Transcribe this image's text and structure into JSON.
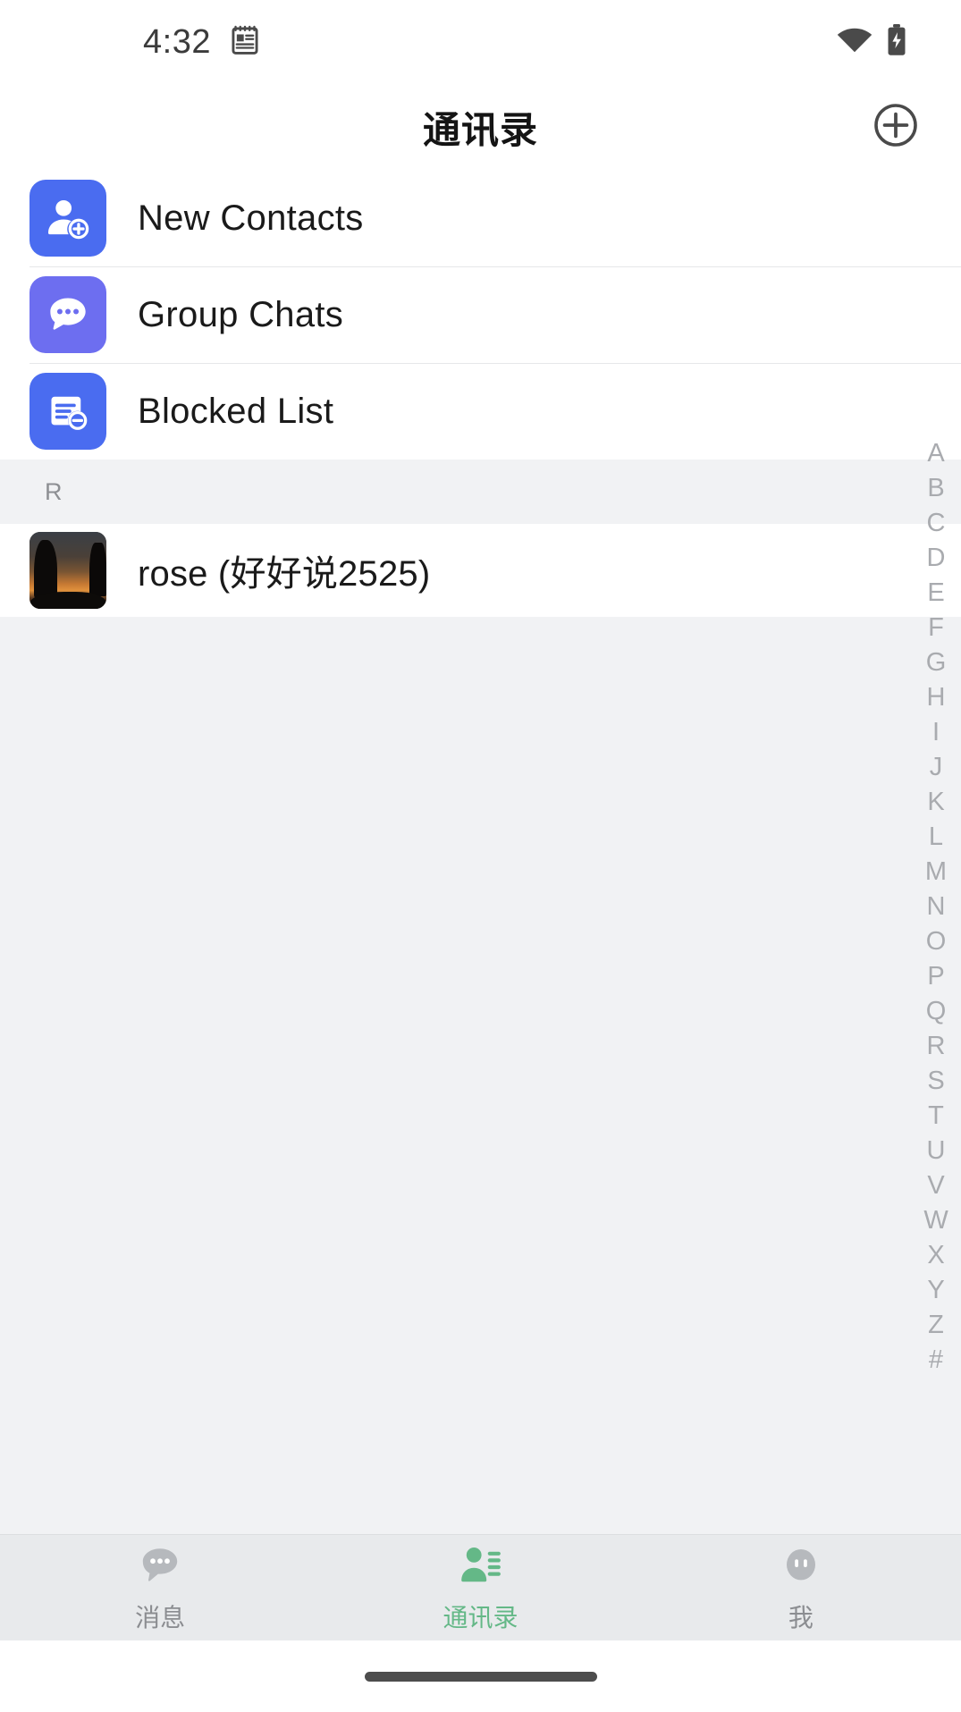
{
  "status_bar": {
    "time": "4:32",
    "calendar_icon": "calendar-icon",
    "wifi_icon": "wifi-icon",
    "battery_icon": "battery-charging-icon"
  },
  "header": {
    "title": "通讯录",
    "add_icon": "plus-circle-icon"
  },
  "menu": {
    "items": [
      {
        "label": "New Contacts",
        "icon": "person-add-icon",
        "color": "#4a6cf0"
      },
      {
        "label": "Group Chats",
        "icon": "chat-bubble-icon",
        "color": "#6d6ef0"
      },
      {
        "label": "Blocked List",
        "icon": "blocked-document-icon",
        "color": "#4a6cf0"
      }
    ]
  },
  "sections": [
    {
      "letter": "R",
      "contacts": [
        {
          "name": "rose (好好说2525)",
          "avatar": "sunset-photo-avatar"
        }
      ]
    }
  ],
  "alpha_index": {
    "letters": [
      "A",
      "B",
      "C",
      "D",
      "E",
      "F",
      "G",
      "H",
      "I",
      "J",
      "K",
      "L",
      "M",
      "N",
      "O",
      "P",
      "Q",
      "R",
      "S",
      "T",
      "U",
      "V",
      "W",
      "X",
      "Y",
      "Z",
      "#"
    ]
  },
  "bottom_nav": {
    "items": [
      {
        "label": "消息",
        "icon": "messages-bubble-icon",
        "active": false
      },
      {
        "label": "通讯录",
        "icon": "contacts-person-icon",
        "active": true
      },
      {
        "label": "我",
        "icon": "profile-face-icon",
        "active": false
      }
    ]
  },
  "colors": {
    "accent_blue": "#4a6cf0",
    "accent_purple": "#6d6ef0",
    "active_green": "#64b887",
    "page_bg": "#f1f2f4",
    "nav_bg": "#e8eaec"
  }
}
